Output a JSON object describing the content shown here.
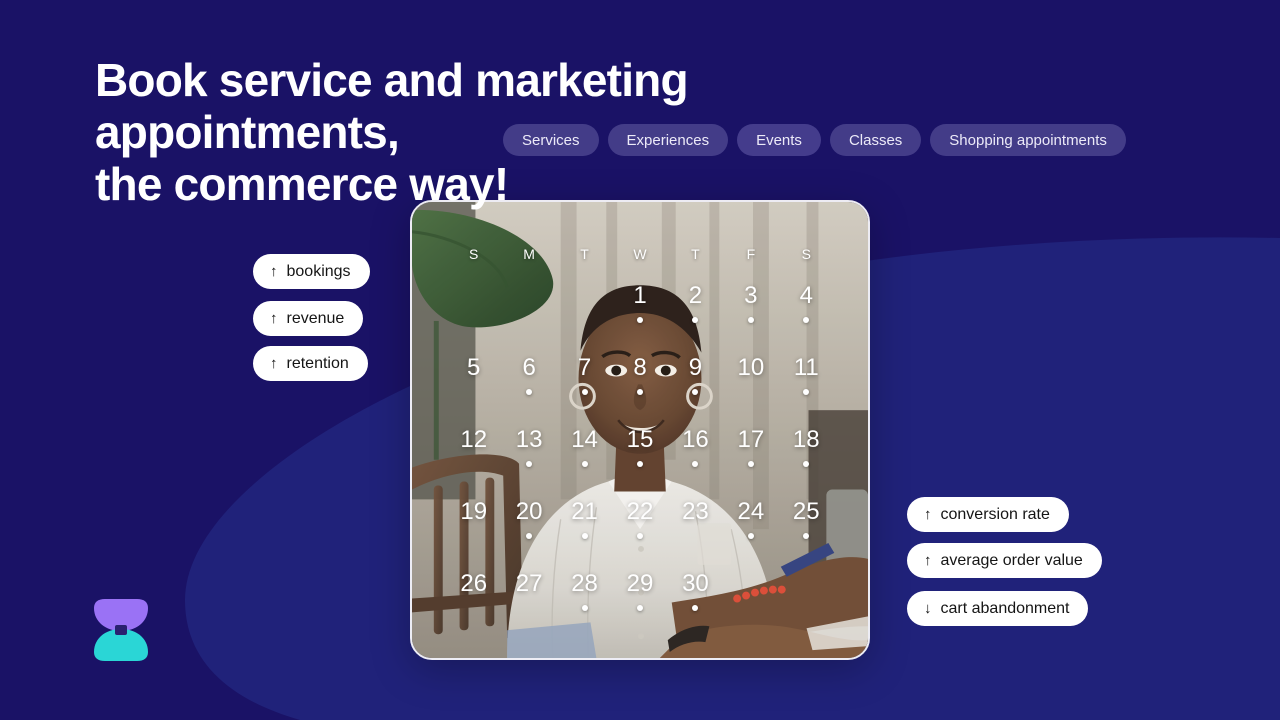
{
  "theme": {
    "background": "#1a1266",
    "background_accent": "#20227a",
    "pill_white": "#ffffff",
    "pill_translucent": "rgba(185,180,235,0.26)",
    "text_light": "#ffffff",
    "text_dark": "#151515",
    "logo_purple": "#9a72f5",
    "logo_cyan": "#2ad6d6"
  },
  "headline": {
    "text": "Book service and marketing appointments,\nthe commerce way!"
  },
  "categories": [
    {
      "label": "Services",
      "style": "default"
    },
    {
      "label": "Experiences",
      "style": "default"
    },
    {
      "label": "Events",
      "style": "alt"
    },
    {
      "label": "Classes",
      "style": "default"
    },
    {
      "label": "Shopping appointments",
      "style": "default"
    }
  ],
  "metrics_left": [
    {
      "arrow": "↑",
      "label": "bookings",
      "direction": "up"
    },
    {
      "arrow": "↑",
      "label": "revenue",
      "direction": "up"
    },
    {
      "arrow": "↑",
      "label": "retention",
      "direction": "up"
    }
  ],
  "metrics_right": [
    {
      "arrow": "↑",
      "label": "conversion rate",
      "direction": "up"
    },
    {
      "arrow": "↑",
      "label": "average order value",
      "direction": "up"
    },
    {
      "arrow": "↓",
      "label": "cart abandonment",
      "direction": "down"
    }
  ],
  "calendar": {
    "weekday_headers": [
      "S",
      "M",
      "T",
      "W",
      "T",
      "F",
      "S"
    ],
    "first_day_column": 3,
    "weeks": [
      [
        {
          "day": null,
          "dot": false
        },
        {
          "day": null,
          "dot": false
        },
        {
          "day": null,
          "dot": false
        },
        {
          "day": "1",
          "dot": true
        },
        {
          "day": "2",
          "dot": true
        },
        {
          "day": "3",
          "dot": true
        },
        {
          "day": "4",
          "dot": true
        }
      ],
      [
        {
          "day": "5",
          "dot": false
        },
        {
          "day": "6",
          "dot": true
        },
        {
          "day": "7",
          "dot": true
        },
        {
          "day": "8",
          "dot": true
        },
        {
          "day": "9",
          "dot": true
        },
        {
          "day": "10",
          "dot": false
        },
        {
          "day": "11",
          "dot": true
        }
      ],
      [
        {
          "day": "12",
          "dot": false
        },
        {
          "day": "13",
          "dot": true
        },
        {
          "day": "14",
          "dot": true
        },
        {
          "day": "15",
          "dot": true
        },
        {
          "day": "16",
          "dot": true
        },
        {
          "day": "17",
          "dot": true
        },
        {
          "day": "18",
          "dot": true
        }
      ],
      [
        {
          "day": "19",
          "dot": false
        },
        {
          "day": "20",
          "dot": true
        },
        {
          "day": "21",
          "dot": true
        },
        {
          "day": "22",
          "dot": true
        },
        {
          "day": "23",
          "dot": false
        },
        {
          "day": "24",
          "dot": true
        },
        {
          "day": "25",
          "dot": true
        }
      ],
      [
        {
          "day": "26",
          "dot": false
        },
        {
          "day": "27",
          "dot": false
        },
        {
          "day": "28",
          "dot": true
        },
        {
          "day": "29",
          "dot": true
        },
        {
          "day": "30",
          "dot": true
        },
        {
          "day": null,
          "dot": false
        },
        {
          "day": null,
          "dot": false
        }
      ]
    ]
  },
  "logo": {
    "name": "hourglass-logo"
  }
}
